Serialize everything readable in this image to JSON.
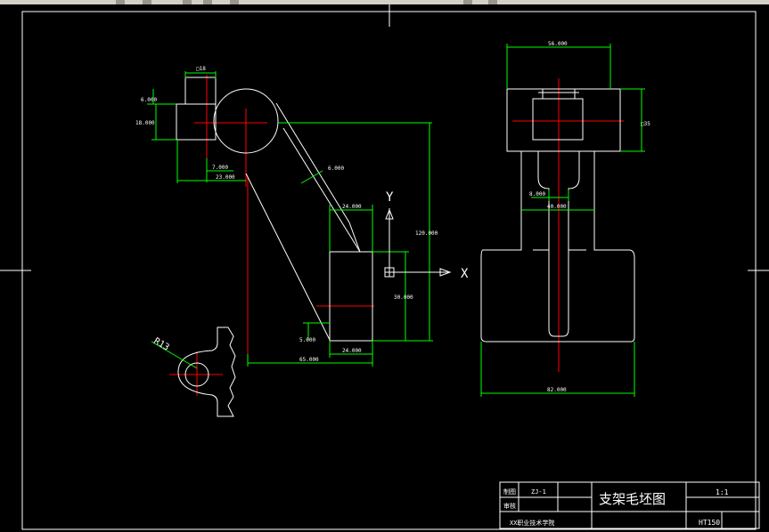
{
  "toolbar": {
    "visible_strip": true
  },
  "dimensions": {
    "left_square_18": "□18",
    "d_6": "6.000",
    "d_18": "18.000",
    "d_7": "7.000",
    "d_23": "23.000",
    "d_6_rib": "6.000",
    "d_24_top": "24.000",
    "d_120": "120.000",
    "d_30": "30.000",
    "d_5": "5.000",
    "d_24_bottom": "24.000",
    "d_65": "65.000",
    "radius": "R13",
    "right_56": "56.000",
    "right_square_35": "□35",
    "right_8": "8.000",
    "right_40": "40.000",
    "right_82": "82.000"
  },
  "ucs": {
    "y_label": "Y",
    "x_label": "X"
  },
  "title_block": {
    "title": "支架毛坯图",
    "scale": "1:1",
    "material": "HT150",
    "label_drawing": "制图",
    "label_check": "审核",
    "drawing_no": "ZJ-1",
    "school": "XX职业技术学院"
  },
  "colors": {
    "background": "#000000",
    "dimension": "#00ff00",
    "outline": "#ffffff",
    "center": "#ff0000"
  }
}
